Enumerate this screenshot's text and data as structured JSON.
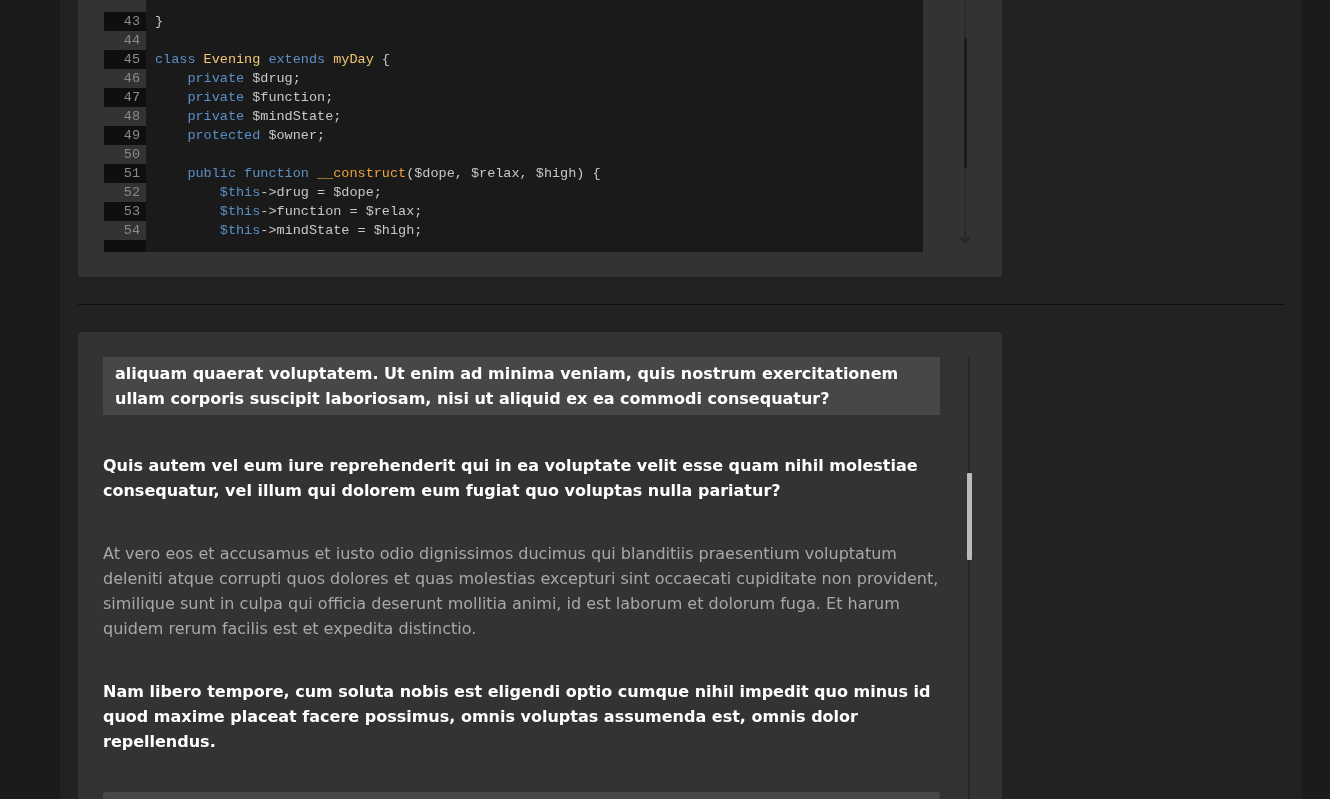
{
  "code_panel": {
    "lines": [
      {
        "number": "43",
        "tokens": [
          {
            "kind": "plain",
            "text": "}"
          }
        ]
      },
      {
        "number": "44"
      },
      {
        "number": "45",
        "tokens": [
          {
            "kind": "kw",
            "text": "class "
          },
          {
            "kind": "name",
            "text": "Evening "
          },
          {
            "kind": "kw",
            "text": "extends "
          },
          {
            "kind": "name",
            "text": "myDay "
          },
          {
            "kind": "plain",
            "text": "{"
          }
        ]
      },
      {
        "number": "46",
        "tokens": [
          {
            "kind": "kw",
            "text": "    private "
          },
          {
            "kind": "plain",
            "text": "$drug;"
          }
        ]
      },
      {
        "number": "47",
        "tokens": [
          {
            "kind": "kw",
            "text": "    private "
          },
          {
            "kind": "plain",
            "text": "$function;"
          }
        ]
      },
      {
        "number": "48",
        "tokens": [
          {
            "kind": "kw",
            "text": "    private "
          },
          {
            "kind": "plain",
            "text": "$mindState;"
          }
        ]
      },
      {
        "number": "49",
        "tokens": [
          {
            "kind": "kw",
            "text": "    protected "
          },
          {
            "kind": "plain",
            "text": "$owner;"
          }
        ]
      },
      {
        "number": "50"
      },
      {
        "number": "51",
        "tokens": [
          {
            "kind": "kw",
            "text": "    public function "
          },
          {
            "kind": "fn",
            "text": "__construct"
          },
          {
            "kind": "plain",
            "text": "($dope, $relax, $high) {"
          }
        ]
      },
      {
        "number": "52",
        "tokens": [
          {
            "kind": "kw",
            "text": "        $this"
          },
          {
            "kind": "plain",
            "text": "->drug = $dope;"
          }
        ]
      },
      {
        "number": "53",
        "tokens": [
          {
            "kind": "kw",
            "text": "        $this"
          },
          {
            "kind": "plain",
            "text": "->function = $relax;"
          }
        ]
      },
      {
        "number": "54",
        "tokens": [
          {
            "kind": "kw",
            "text": "        $this"
          },
          {
            "kind": "plain",
            "text": "->mindState = $high;"
          }
        ]
      }
    ]
  },
  "article": {
    "blocks": [
      {
        "kind": "quote",
        "text": "aliquam quaerat voluptatem. Ut enim ad minima veniam, quis nostrum exercitationem ullam corporis suscipit laboriosam, nisi ut aliquid ex ea commodi consequatur?"
      },
      {
        "kind": "strong",
        "text": "Quis autem vel eum iure reprehenderit qui in ea voluptate velit esse quam nihil molestiae consequatur, vel illum qui dolorem eum fugiat quo voluptas nulla pariatur?"
      },
      {
        "kind": "muted",
        "text": "At vero eos et accusamus et iusto odio dignissimos ducimus qui blanditiis praesentium voluptatum deleniti atque corrupti quos dolores et quas molestias excepturi sint occaecati cupiditate non provident, similique sunt in culpa qui officia deserunt mollitia animi, id est laborum et dolorum fuga. Et harum quidem rerum facilis est et expedita distinctio."
      },
      {
        "kind": "strong",
        "text": "Nam libero tempore, cum soluta nobis est eligendi optio cumque nihil impedit quo minus id quod maxime placeat facere possimus, omnis voluptas assumenda est, omnis dolor repellendus."
      }
    ]
  }
}
